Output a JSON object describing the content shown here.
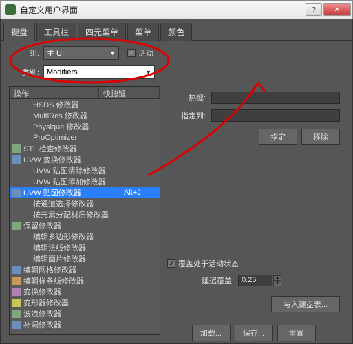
{
  "window": {
    "title": "自定义用户界面"
  },
  "tabs": [
    "键盘",
    "工具栏",
    "四元菜单",
    "菜单",
    "颜色"
  ],
  "group": {
    "label": "组:",
    "value": "主 UI"
  },
  "active": {
    "label": "活动",
    "checked": true
  },
  "category": {
    "label": "类别:",
    "value": "Modifiers"
  },
  "list": {
    "head_op": "操作",
    "head_sc": "快捷键",
    "items": [
      {
        "icon": "none",
        "indent": true,
        "text": "HSDS 修改器",
        "sc": ""
      },
      {
        "icon": "none",
        "indent": true,
        "text": "MultiRes 修改器",
        "sc": ""
      },
      {
        "icon": "none",
        "indent": true,
        "text": "Physique 修改器",
        "sc": ""
      },
      {
        "icon": "none",
        "indent": true,
        "text": "ProOptimizer",
        "sc": ""
      },
      {
        "icon": "g",
        "indent": false,
        "text": "STL 检查修改器",
        "sc": ""
      },
      {
        "icon": "b",
        "indent": false,
        "text": "UVW 变换修改器",
        "sc": ""
      },
      {
        "icon": "none",
        "indent": true,
        "text": "UVW 贴图清除修改器",
        "sc": ""
      },
      {
        "icon": "none",
        "indent": true,
        "text": "UVW 贴图添加修改器",
        "sc": ""
      },
      {
        "icon": "b",
        "indent": false,
        "text": "UVW 贴图修改器",
        "sc": "Alt+J",
        "sel": true
      },
      {
        "icon": "none",
        "indent": true,
        "text": "按通道选择修改器",
        "sc": ""
      },
      {
        "icon": "none",
        "indent": true,
        "text": "按元素分配材质修改器",
        "sc": ""
      },
      {
        "icon": "g",
        "indent": false,
        "text": "保留修改器",
        "sc": ""
      },
      {
        "icon": "none",
        "indent": true,
        "text": "编辑多边形修改器",
        "sc": ""
      },
      {
        "icon": "none",
        "indent": true,
        "text": "编辑法线修改器",
        "sc": ""
      },
      {
        "icon": "none",
        "indent": true,
        "text": "编辑面片修改器",
        "sc": ""
      },
      {
        "icon": "b",
        "indent": false,
        "text": "编辑网格修改器",
        "sc": ""
      },
      {
        "icon": "o",
        "indent": false,
        "text": "编辑样条线修改器",
        "sc": ""
      },
      {
        "icon": "p",
        "indent": false,
        "text": "变换修改器",
        "sc": ""
      },
      {
        "icon": "y",
        "indent": false,
        "text": "变形器修改器",
        "sc": ""
      },
      {
        "icon": "g",
        "indent": false,
        "text": "波浪修改器",
        "sc": ""
      },
      {
        "icon": "b",
        "indent": false,
        "text": "补洞修改器",
        "sc": ""
      }
    ]
  },
  "hotkey": {
    "label": "热键:"
  },
  "assignto": {
    "label": "指定到:"
  },
  "assign_btn": "指定",
  "remove_btn": "移除",
  "override": {
    "label": "覆盖处于活动状态",
    "checked": true
  },
  "delay": {
    "label": "延迟覆盖:",
    "value": "0.25"
  },
  "write_btn": "写入键盘表...",
  "load_btn": "加载...",
  "save_btn": "保存...",
  "reset_btn": "重置"
}
